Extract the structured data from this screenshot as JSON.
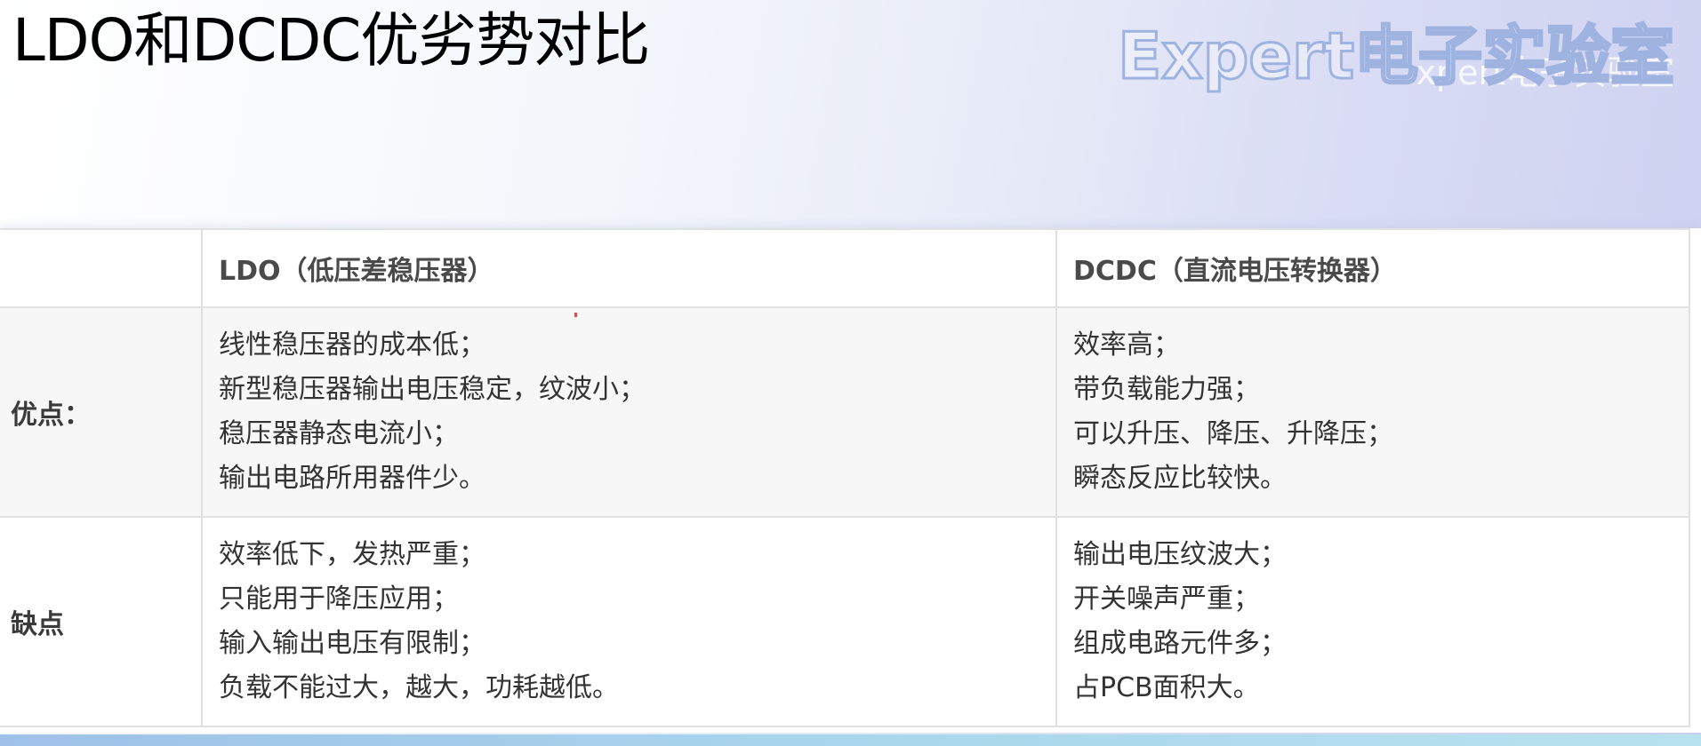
{
  "page": {
    "title": "LDO和DCDC优劣势对比",
    "watermark": "Expert电子实验室",
    "watermark_ghost": "xpert电子实验室"
  },
  "table": {
    "headers": [
      "",
      "LDO（低压差稳压器）",
      "DCDC（直流电压转换器）"
    ],
    "rows": [
      {
        "label": "优点：",
        "ldo": [
          "线性稳压器的成本低；",
          "新型稳压器输出电压稳定，纹波小；",
          "稳压器静态电流小；",
          "输出电路所用器件少。"
        ],
        "dcdc": [
          "效率高；",
          "带负载能力强；",
          "可以升压、降压、升降压；",
          "瞬态反应比较快。"
        ]
      },
      {
        "label": "缺点",
        "ldo": [
          "效率低下，发热严重；",
          "只能用于降压应用；",
          "输入输出电压有限制；",
          "负载不能过大，越大，功耗越低。"
        ],
        "dcdc": [
          "输出电压纹波大；",
          "开关噪声严重；",
          "组成电路元件多；",
          "占PCB面积大。"
        ]
      }
    ]
  },
  "colors": {
    "header_bg_start": "#ffffff",
    "header_bg_end": "#cdd0f0",
    "pro_row_bg": "#f7f7f7",
    "grid_line": "#e1e1e1",
    "watermark_stroke": "#9fb3e0",
    "bottom_bar": "#a9d6ec"
  }
}
